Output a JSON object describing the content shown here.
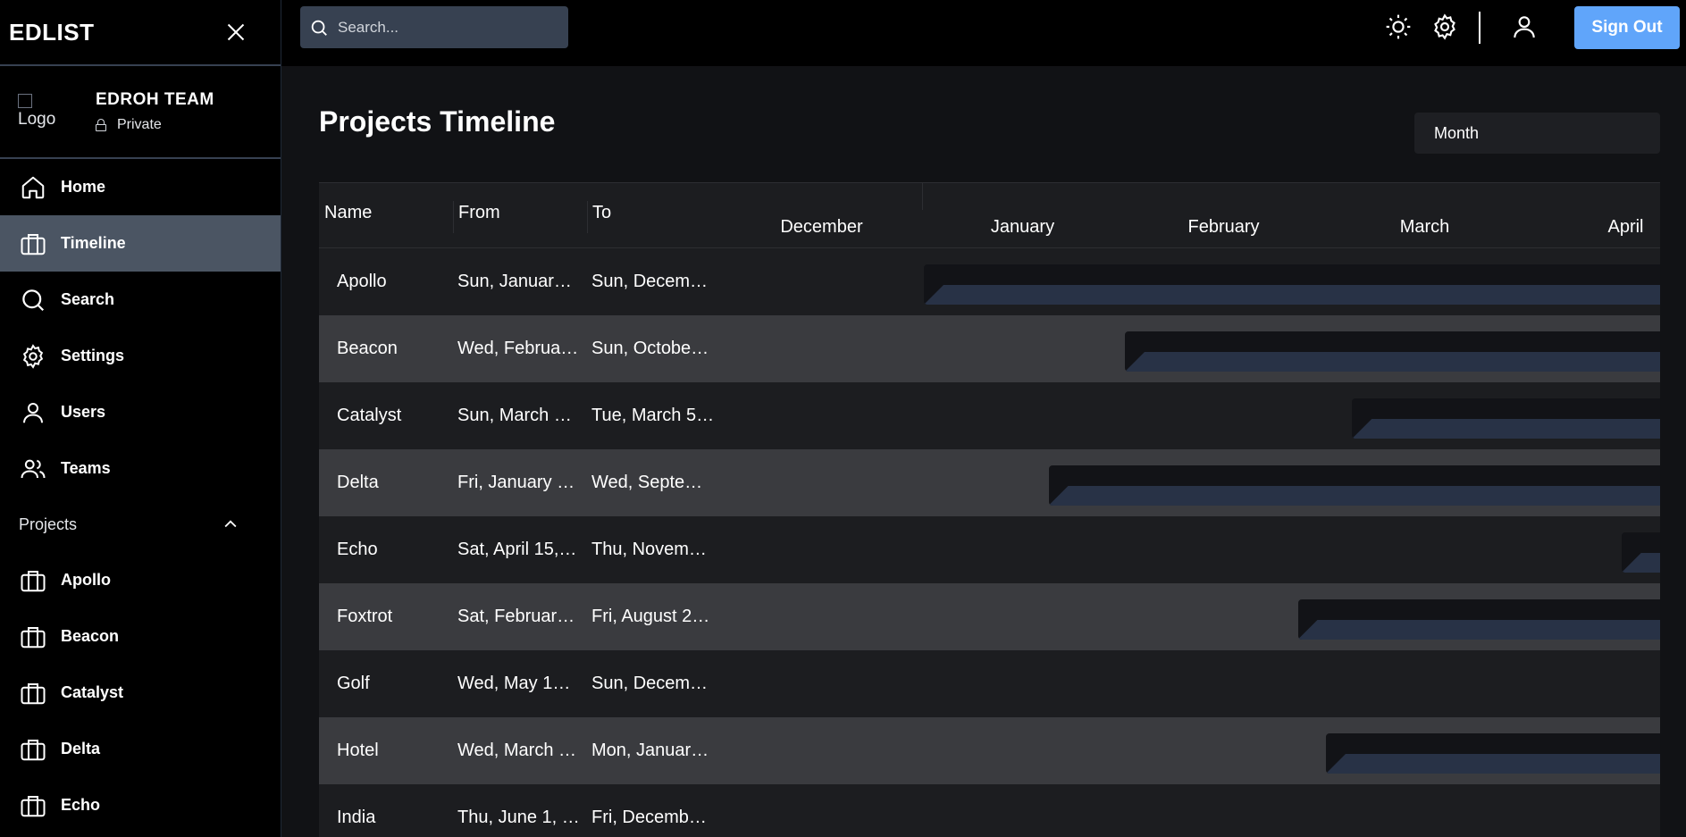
{
  "sidebar": {
    "brand": "EDLIST",
    "team": {
      "logo_alt": "Logo",
      "name": "EDROH TEAM",
      "privacy": "Private"
    },
    "nav": [
      {
        "label": "Home",
        "icon": "home-icon"
      },
      {
        "label": "Timeline",
        "icon": "briefcase-icon",
        "active": true
      },
      {
        "label": "Search",
        "icon": "search-icon"
      },
      {
        "label": "Settings",
        "icon": "gear-icon"
      },
      {
        "label": "Users",
        "icon": "user-icon"
      },
      {
        "label": "Teams",
        "icon": "users-icon"
      }
    ],
    "projects_section": {
      "label": "Projects",
      "items": [
        "Apollo",
        "Beacon",
        "Catalyst",
        "Delta",
        "Echo"
      ]
    }
  },
  "header": {
    "search_placeholder": "Search...",
    "sign_out": "Sign Out"
  },
  "main": {
    "title": "Projects Timeline",
    "view_mode": "Month",
    "columns": {
      "name": "Name",
      "from": "From",
      "to": "To"
    },
    "months": [
      "December",
      "January",
      "February",
      "March",
      "April"
    ],
    "rows": [
      {
        "name": "Apollo",
        "from": "Sun, Januar…",
        "to": "Sun, Decem…",
        "bar_start_month": 1.0
      },
      {
        "name": "Beacon",
        "from": "Wed, Februa…",
        "to": "Sun, Octobe…",
        "bar_start_month": 2.0
      },
      {
        "name": "Catalyst",
        "from": "Sun, March …",
        "to": "Tue, March 5…",
        "bar_start_month": 3.13
      },
      {
        "name": "Delta",
        "from": "Fri, January …",
        "to": "Wed, Septe…",
        "bar_start_month": 1.62
      },
      {
        "name": "Echo",
        "from": "Sat, April 15,…",
        "to": "Thu, Novem…",
        "bar_start_month": 4.47
      },
      {
        "name": "Foxtrot",
        "from": "Sat, Februar…",
        "to": "Fri, August 2…",
        "bar_start_month": 2.86
      },
      {
        "name": "Golf",
        "from": "Wed, May 1…",
        "to": "Sun, Decem…",
        "bar_start_month": null
      },
      {
        "name": "Hotel",
        "from": "Wed, March …",
        "to": "Mon, Januar…",
        "bar_start_month": 3.0
      },
      {
        "name": "India",
        "from": "Thu, June 1, …",
        "to": "Fri, Decemb…",
        "bar_start_month": null
      }
    ]
  }
}
